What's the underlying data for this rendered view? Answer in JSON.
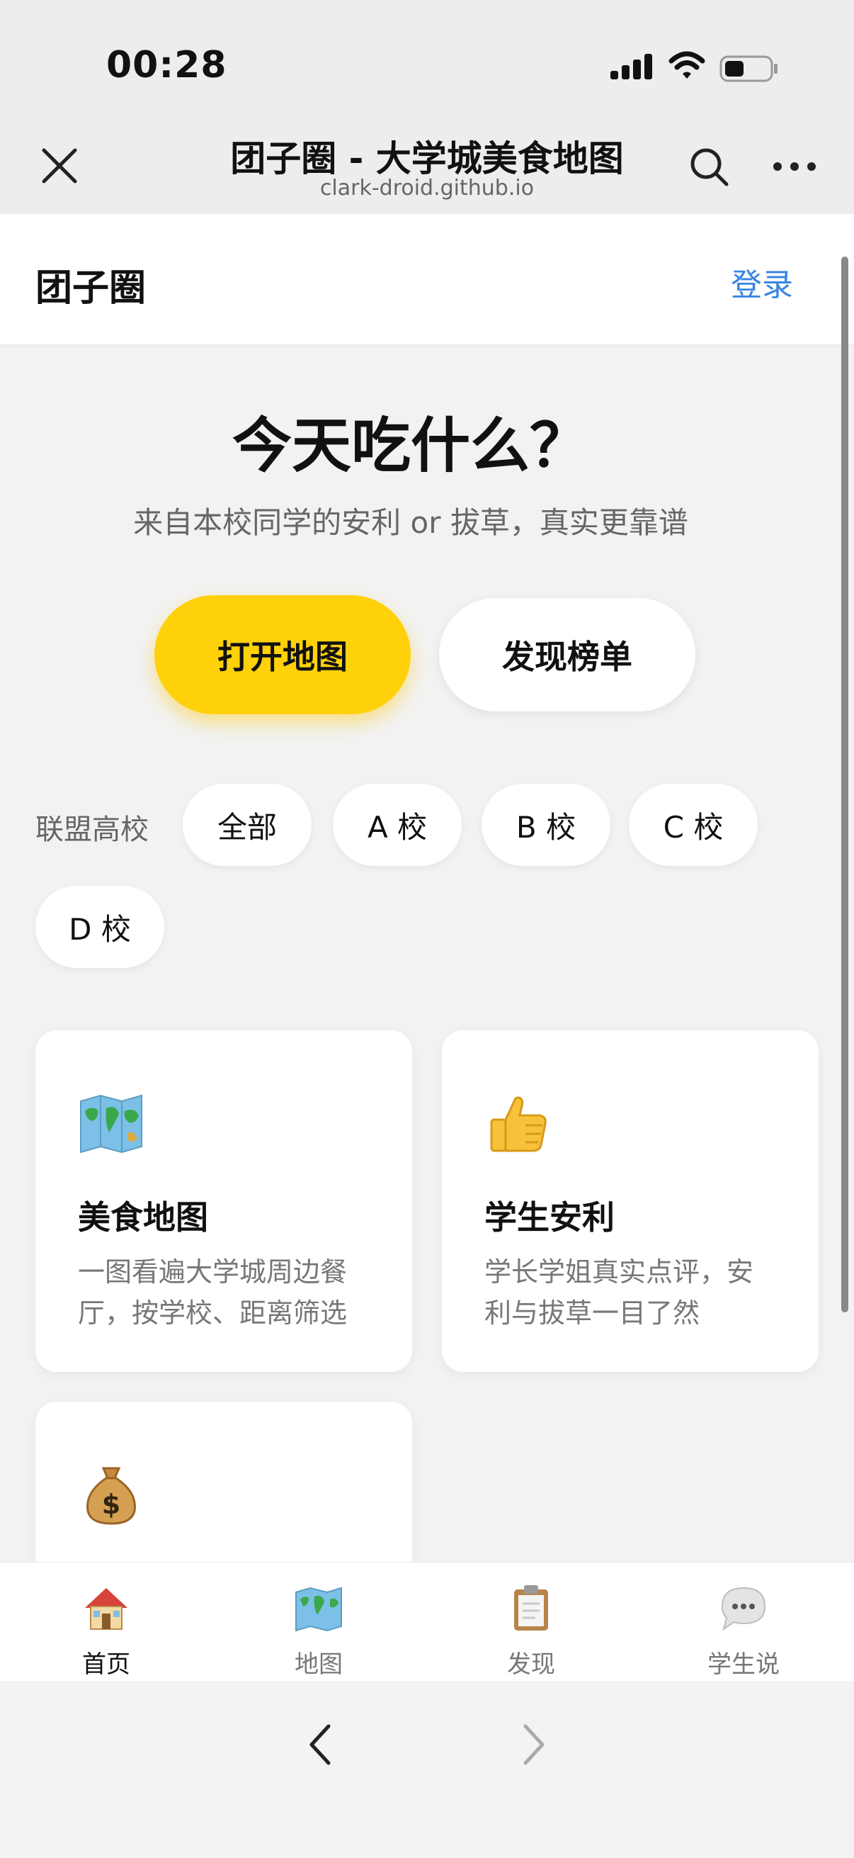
{
  "status_bar": {
    "time": "00:28"
  },
  "topnav": {
    "title": "团子圈 - 大学城美食地图",
    "url": "clark-droid.github.io"
  },
  "header": {
    "logo": "团子圈",
    "login": "登录"
  },
  "hero": {
    "title": "今天吃什么？",
    "subtitle": "来自本校同学的安利 or 拔草，真实更靠谱",
    "primary_button": "打开地图",
    "secondary_button": "发现榜单"
  },
  "filter": {
    "label": "联盟高校",
    "chips": [
      "全部",
      "A 校",
      "B 校",
      "C 校",
      "D 校"
    ]
  },
  "cards": [
    {
      "icon": "world-map-icon",
      "title": "美食地图",
      "desc_line1": "一图看遍大学城周边餐",
      "desc_line2": "厅，按学校、距离筛选"
    },
    {
      "icon": "thumbs-up-icon",
      "title": "学生安利",
      "desc_line1": "学长学姐真实点评，安",
      "desc_line2": "利与拔草一目了然"
    },
    {
      "icon": "money-bag-icon"
    }
  ],
  "tabbar": {
    "tabs": [
      {
        "icon": "house-icon",
        "label": "首页",
        "active": true
      },
      {
        "icon": "world-map-icon",
        "label": "地图",
        "active": false
      },
      {
        "icon": "clipboard-icon",
        "label": "发现",
        "active": false
      },
      {
        "icon": "speech-bubble-icon",
        "label": "学生说",
        "active": false
      }
    ]
  },
  "colors": {
    "accent_yellow": "#ffd10a",
    "link_blue": "#3a86e0",
    "background": "#f2f2f2"
  }
}
